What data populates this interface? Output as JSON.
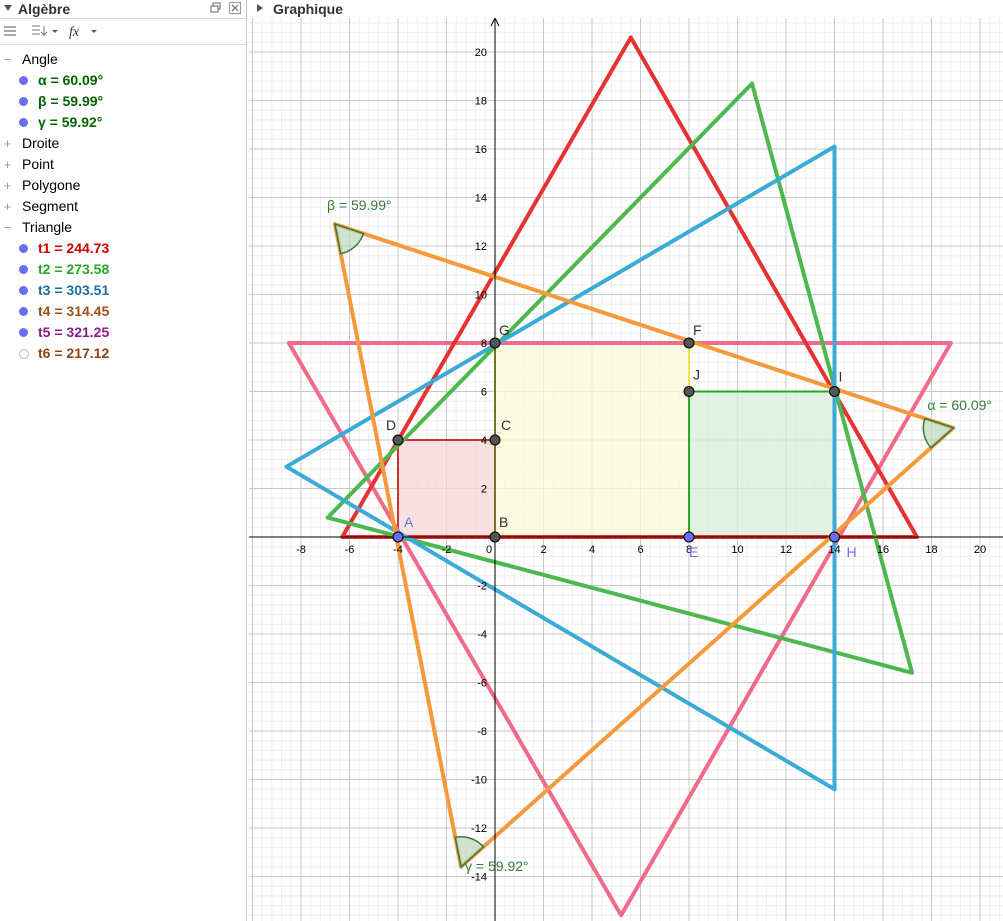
{
  "algebra": {
    "title": "Algèbre",
    "categories": [
      {
        "label": "Angle",
        "expanded": true,
        "items": [
          {
            "text": "α = 60.09°",
            "color": "#006400",
            "visible": true
          },
          {
            "text": "β = 59.99°",
            "color": "#006400",
            "visible": true
          },
          {
            "text": "γ = 59.92°",
            "color": "#006400",
            "visible": true
          }
        ]
      },
      {
        "label": "Droite",
        "expanded": false,
        "items": []
      },
      {
        "label": "Point",
        "expanded": false,
        "items": []
      },
      {
        "label": "Polygone",
        "expanded": false,
        "items": []
      },
      {
        "label": "Segment",
        "expanded": false,
        "items": []
      },
      {
        "label": "Triangle",
        "expanded": true,
        "items": [
          {
            "text": "t1 = 244.73",
            "color": "#cc0000",
            "visible": true
          },
          {
            "text": "t2 = 273.58",
            "color": "#22aa22",
            "visible": true
          },
          {
            "text": "t3 = 303.51",
            "color": "#1a6fa0",
            "visible": true
          },
          {
            "text": "t4 = 314.45",
            "color": "#a0521a",
            "visible": true
          },
          {
            "text": "t5 = 321.25",
            "color": "#8b1a8b",
            "visible": true
          },
          {
            "text": "t6 = 217.12",
            "color": "#8b4513",
            "visible": false
          }
        ]
      }
    ]
  },
  "graphics": {
    "title": "Graphique",
    "x_ticks": [
      "-8",
      "-6",
      "-4",
      "-2",
      "0",
      "2",
      "4",
      "6",
      "8",
      "10",
      "12",
      "14",
      "16",
      "18",
      "20"
    ],
    "y_ticks": [
      "20",
      "18",
      "16",
      "14",
      "12",
      "10",
      "8",
      "6",
      "4",
      "2",
      "-2",
      "-4",
      "-6",
      "-8",
      "-10",
      "-12",
      "-14"
    ],
    "triangles": [
      {
        "color": "#f06a8a",
        "points": [
          [
            -8.5,
            8
          ],
          [
            18.8,
            8
          ],
          [
            5.2,
            -15.6
          ]
        ]
      },
      {
        "color": "#e63232",
        "points": [
          [
            -6.3,
            0
          ],
          [
            17.4,
            0
          ],
          [
            5.6,
            20.6
          ]
        ]
      },
      {
        "color": "#4db84d",
        "points": [
          [
            -6.9,
            0.8
          ],
          [
            10.6,
            18.7
          ],
          [
            17.2,
            -5.6
          ]
        ]
      },
      {
        "color": "#3aabd6",
        "points": [
          [
            -8.6,
            2.9
          ],
          [
            14,
            16.1
          ],
          [
            14,
            -10.4
          ]
        ]
      },
      {
        "color": "#f59a3a",
        "points": [
          [
            -6.6,
            12.9
          ],
          [
            -1.4,
            -13.6
          ],
          [
            18.9,
            4.5
          ]
        ]
      }
    ],
    "polygons": [
      {
        "fill": "#f7d7d7",
        "stroke": "#cc3333",
        "points": [
          [
            -4,
            0
          ],
          [
            0,
            0
          ],
          [
            0,
            4
          ],
          [
            -4,
            4
          ]
        ]
      },
      {
        "fill": "#fbfbd8",
        "stroke": "#e8e84a",
        "points": [
          [
            0,
            0
          ],
          [
            8,
            0
          ],
          [
            8,
            8
          ],
          [
            0,
            8
          ]
        ]
      },
      {
        "fill": "#d8eed8",
        "stroke": "#22aa22",
        "points": [
          [
            8,
            0
          ],
          [
            14,
            0
          ],
          [
            14,
            6
          ],
          [
            8,
            6
          ]
        ]
      }
    ],
    "points": [
      {
        "label": "A",
        "x": -4,
        "y": 0,
        "free": true
      },
      {
        "label": "B",
        "x": 0,
        "y": 0,
        "free": false
      },
      {
        "label": "C",
        "x": 0,
        "y": 4,
        "free": false
      },
      {
        "label": "D",
        "x": -4,
        "y": 4,
        "free": false
      },
      {
        "label": "E",
        "x": 8,
        "y": 0,
        "free": true
      },
      {
        "label": "F",
        "x": 8,
        "y": 8,
        "free": false
      },
      {
        "label": "G",
        "x": 0,
        "y": 8,
        "free": false
      },
      {
        "label": "H",
        "x": 14,
        "y": 0,
        "free": true
      },
      {
        "label": "I",
        "x": 14,
        "y": 6,
        "free": false
      },
      {
        "label": "J",
        "x": 8,
        "y": 6,
        "free": false
      }
    ],
    "angle_labels": [
      {
        "text": "β = 59.99°",
        "x": -6.6,
        "y": 12.9
      },
      {
        "text": "α = 60.09°",
        "x": 18.9,
        "y": 4.5
      },
      {
        "text": "γ = 59.92°",
        "x": -1.4,
        "y": -13.6
      }
    ]
  }
}
